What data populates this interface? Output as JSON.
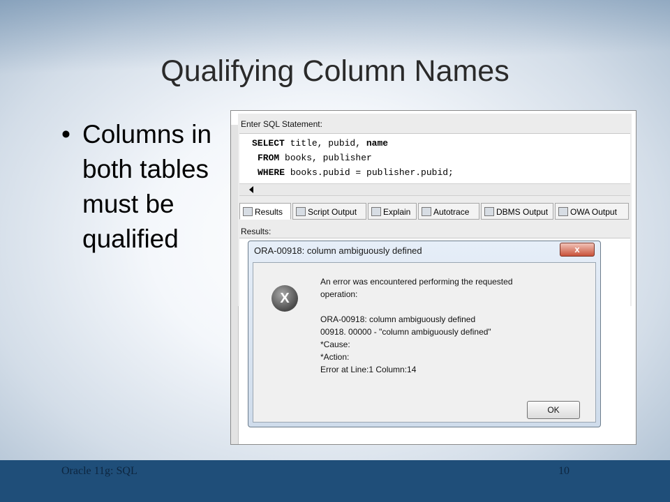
{
  "slide": {
    "title": "Qualifying Column Names",
    "bullet_symbol": "•",
    "bullet_text": "Columns in both tables must be qualified",
    "footer_left": "Oracle 11g: SQL",
    "footer_right": "10"
  },
  "editor": {
    "label": "Enter SQL Statement:",
    "lines": [
      {
        "kw": "SELECT",
        "rest": " title, pubid, ",
        "kw2": "name"
      },
      {
        "kw": "FROM",
        "rest": " books, publisher",
        "kw2": ""
      },
      {
        "kw": "WHERE",
        "rest": " books.pubid = publisher.pubid;",
        "kw2": ""
      }
    ]
  },
  "tabs": [
    {
      "label": "Results",
      "icon": "results-icon"
    },
    {
      "label": "Script Output",
      "icon": "script-output-icon"
    },
    {
      "label": "Explain",
      "icon": "explain-icon"
    },
    {
      "label": "Autotrace",
      "icon": "autotrace-icon"
    },
    {
      "label": "DBMS Output",
      "icon": "dbms-output-icon"
    },
    {
      "label": "OWA Output",
      "icon": "owa-output-icon"
    }
  ],
  "results_label": "Results:",
  "dialog": {
    "title": "ORA-00918: column ambiguously defined",
    "close_label": "x",
    "icon_symbol": "X",
    "message_lines": [
      "An error was encountered performing the requested",
      "operation:",
      "",
      "ORA-00918: column ambiguously defined",
      "00918. 00000 -  \"column ambiguously defined\"",
      "*Cause:",
      "*Action:",
      "Error at Line:1 Column:14"
    ],
    "ok_label": "OK"
  }
}
